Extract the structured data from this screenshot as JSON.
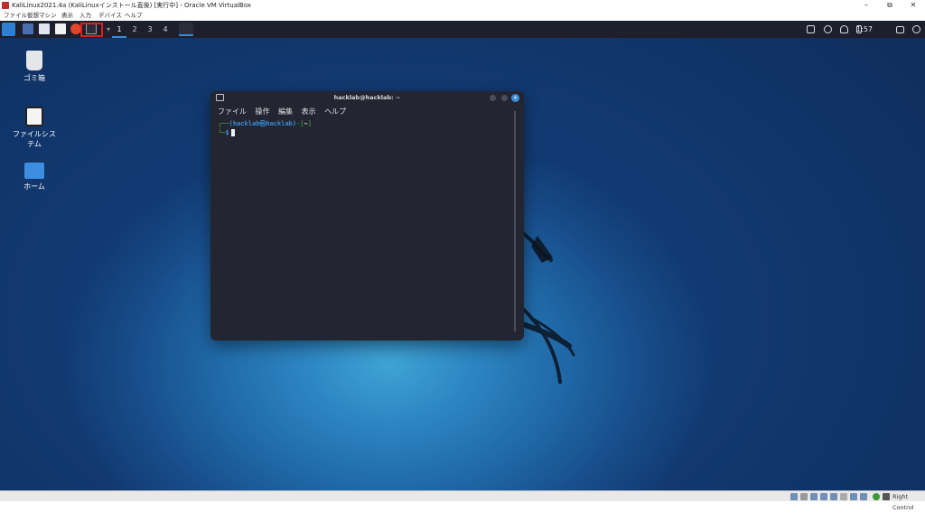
{
  "window": {
    "title": "KaliLinux2021.4a (KaliLinuxインストール直後) [実行中] - Oracle VM VirtualBox",
    "controls": [
      "–",
      "⧉",
      "✕"
    ]
  },
  "vbox_menu": [
    "ファイル",
    "仮想マシン",
    "表示",
    "入力",
    "デバイス",
    "ヘルプ"
  ],
  "panel": {
    "workspaces": [
      "1",
      "2",
      "3",
      "4"
    ],
    "clock": "1:57"
  },
  "desktop_icons": [
    {
      "label": "ゴミ箱",
      "icon": "trash-icon"
    },
    {
      "label": "ファイルシス\nテム",
      "icon": "drive-icon"
    },
    {
      "label": "ホーム",
      "icon": "home-folder-icon"
    }
  ],
  "terminal": {
    "title": "hacklab@hacklab: ~",
    "menu": [
      "ファイル",
      "操作",
      "編集",
      "表示",
      "ヘルプ"
    ],
    "prompt_user": "(hacklab㉿hacklab)",
    "prompt_dir": "~",
    "prompt_prefix_top": "┌──",
    "prompt_bracket_open": "-[",
    "prompt_bracket_close": "]",
    "prompt_prefix_bottom": "└─",
    "prompt_symbol": "$"
  },
  "statusbar": {
    "host_key": "Right Control"
  },
  "colors": {
    "panel": "#1d1f2c",
    "terminal_bg": "#232630",
    "accent": "#3b8bd6",
    "highlight": "#e01d1d"
  }
}
